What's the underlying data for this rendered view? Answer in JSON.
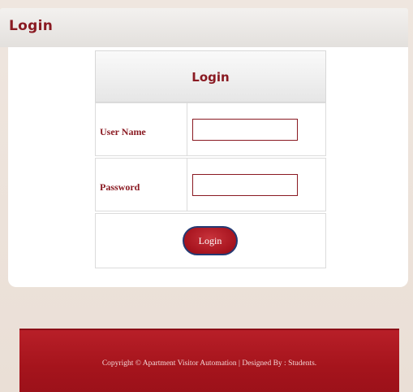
{
  "header": {
    "title": "Login"
  },
  "login_form": {
    "title": "Login",
    "username_label": "User Name",
    "username_value": "",
    "password_label": "Password",
    "password_value": "",
    "submit_label": "Login"
  },
  "footer": {
    "text": "Copyright © Apartment Visitor Automation | Designed By : Students."
  },
  "colors": {
    "brand_red": "#8a1a22",
    "footer_red": "#a5141c",
    "button_border": "#243a73"
  }
}
